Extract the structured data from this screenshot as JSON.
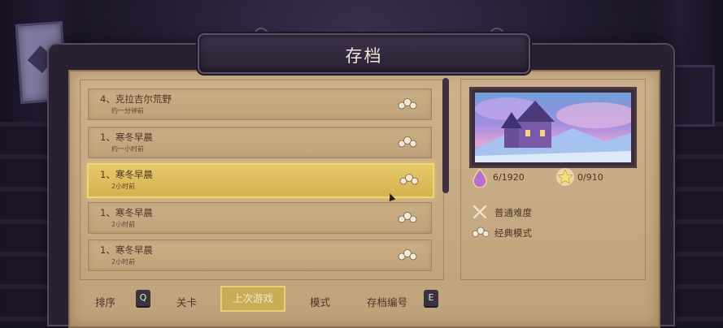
{
  "title": "存档",
  "save_slots": [
    {
      "name": "4、克拉吉尔荒野",
      "time": "约一分钟前",
      "selected": false
    },
    {
      "name": "1、寒冬早晨",
      "time": "约一小时前",
      "selected": false
    },
    {
      "name": "1、寒冬早晨",
      "time": "2小时前",
      "selected": true
    },
    {
      "name": "1、寒冬早晨",
      "time": "2小时前",
      "selected": false
    },
    {
      "name": "1、寒冬早晨",
      "time": "2小时前",
      "selected": false
    }
  ],
  "mode_icon": "triple-cloud-icon",
  "detail": {
    "gems": "6/1920",
    "stars": "0/910",
    "difficulty": "普通难度",
    "mode": "经典模式"
  },
  "sort_bar": {
    "label": "排序",
    "prev_key": "Q",
    "options": [
      "关卡",
      "上次游戏",
      "模式",
      "存档编号"
    ],
    "active_option": "上次游戏",
    "next_key": "E"
  },
  "colors": {
    "panel": "#c4a982",
    "selected": "#e0c060",
    "gem": "#b46fd6",
    "star": "#f3e279"
  }
}
